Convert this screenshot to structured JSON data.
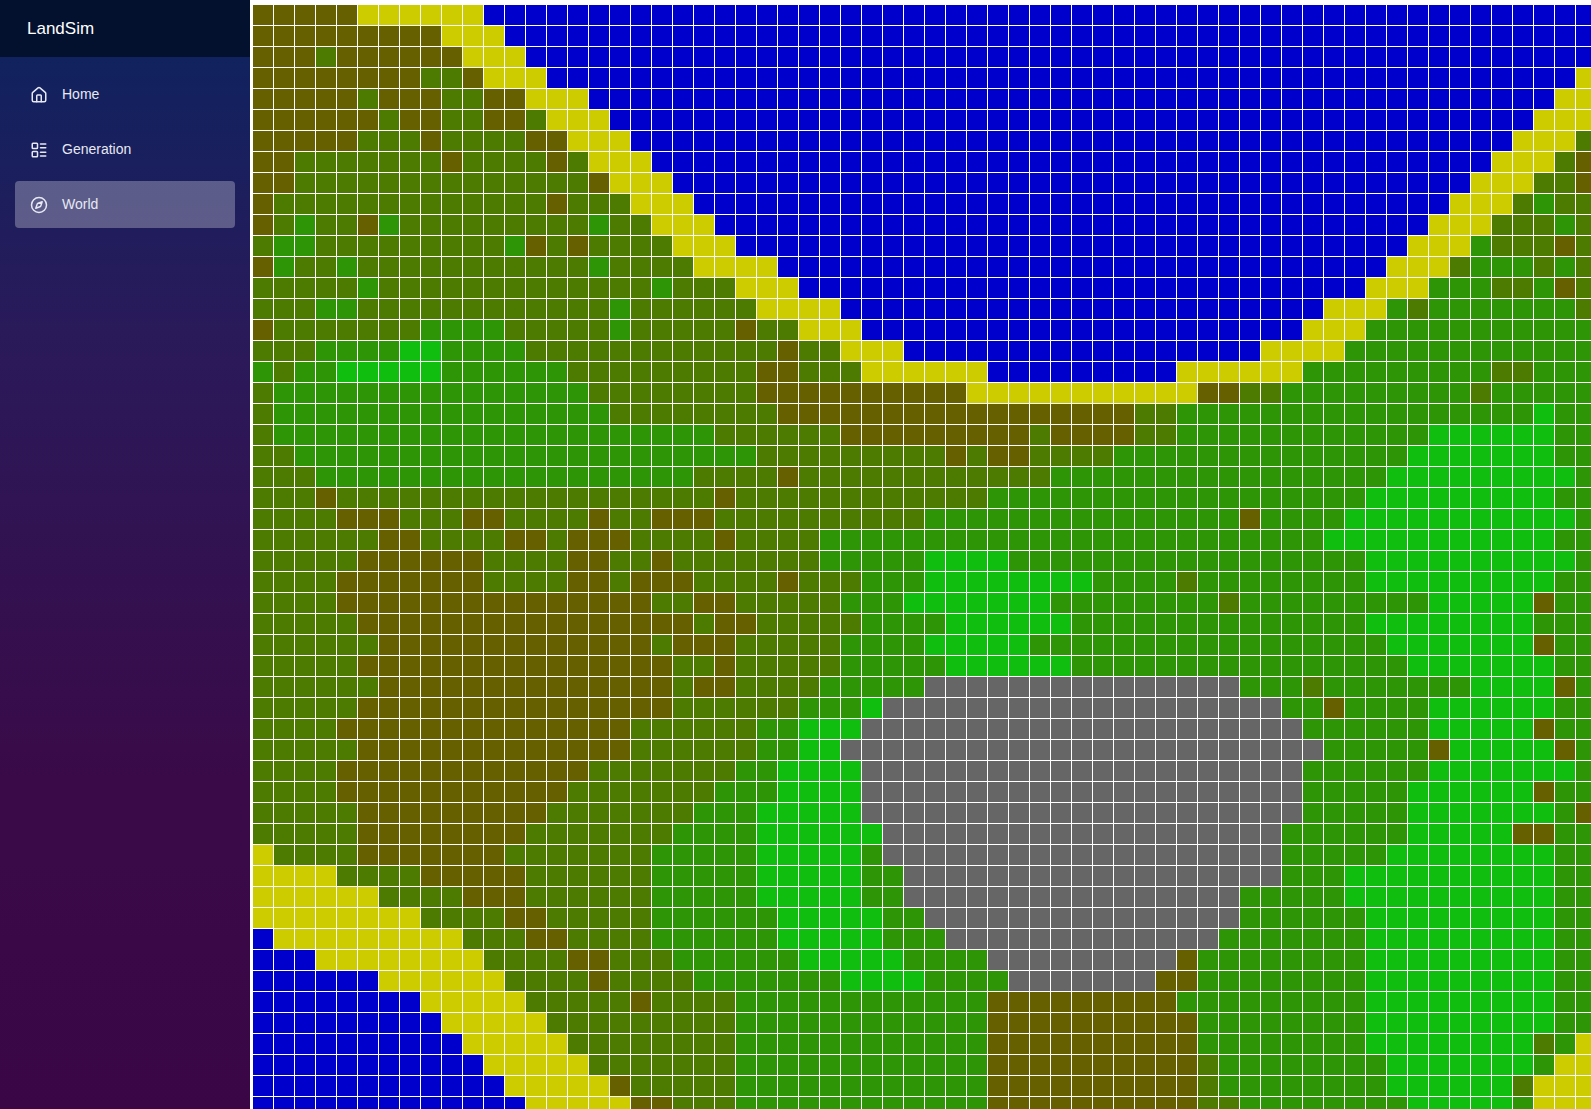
{
  "app": {
    "title": "LandSim"
  },
  "sidebar": {
    "items": [
      {
        "label": "Home",
        "selected": false
      },
      {
        "label": "Generation",
        "selected": false
      },
      {
        "label": "World",
        "selected": true
      }
    ]
  },
  "map": {
    "legend": {
      "W": "#0000cc",
      "Y": "#cccc00",
      "D": "#666000",
      "O": "#4d7a00",
      "G": "#2e9606",
      "L": "#10be10",
      "S": "#666666"
    },
    "rows": [
      "DDDDDYYYYYYWWWWWWWWWWWWWWWWWWWWWWWWWWWWWWWWWWWWWWWWWWWWWWWWWWWWW",
      "DDDDDDDDDYYYWWWWWWWWWWWWWWWWWWWWWWWWWWWWWWWWWWWWWWWWWWWWWWWWWWWW",
      "DDDODDDDDDYYYWWWWWWWWWWWWWWWWWWWWWWWWWWWWWWWWWWWWWWWWWWWWWWWWWWW",
      "DDDDDDDDOODYYYWWWWWWWWWWWWWWWWWWWWWWWWWWWWWWWWWWWWWWWWWWWWWWWWWY",
      "DDDDDODDDOODDYYYWWWWWWWWWWWWWWWWWWWWWWWWWWWWWWWWWWWWWWWWWWWWWWYY",
      "DDDDDDODDOODDOYYYWWWWWWWWWWWWWWWWWWWWWWWWWWWWWWWWWWWWWWWWWWWWYYY",
      "DDDDDOOODOOOODDYYYWWWWWWWWWWWWWWWWWWWWWWWWWWWWWWWWWWWWWWWWWWYYYO",
      "DDOOOOOOODOOOODOYYYWWWWWWWWWWWWWWWWWWWWWWWWWWWWWWWWWWWWWWWWYYYOD",
      "DDOOOOOOOOOOOOOODYYYWWWWWWWWWWWWWWWWWWWWWWWWWWWWWWWWWWWWWWYYYOOD",
      "DOOOOOOOOOOOOODOOOYYYWWWWWWWWWWWWWWWWWWWWWWWWWWWWWWWWWWWWYYYOGOO",
      "DOGOODGOOOOOOOOOGOOYYYWWWWWWWWWWWWWWWWWWWWWWWWWWWWWWWWWWYYYOOOGO",
      "OGGOOOOOOOOOGDODOOOOYYYWWWWWWWWWWWWWWWWWWWWWWWWWWWWWWWWYYYGOOODO",
      "DGOOGOOOOOOOOOOOGOOOOYYYYWWWWWWWWWWWWWWWWWWWWWWWWWWWWWYYYOGGGOGO",
      "OOOOOGOOOOOOOOOOOOOGOOOYYYWWWWWWWWWWWWWWWWWWWWWWWWWWWYYYGGGOOGDO",
      "OOOGGOOOOOOOOOOOOGOOOOOOYYYYWWWWWWWWWWWWWWWWWWWWWWWYYYGOGGGGGGGO",
      "DOOOOOOOGGGGOOOOOGOOOOODOOYYYWWWWWWWWWWWWWWWWWWWWWYYYGGGGGGGGGGG",
      "OOOGGGGLLGGGGOOOOOOOOOOOODOOYYYWWWWWWWWWWWWWWWWWYYYYGGGGGGGGGGGG",
      "GOGGLLLLLGGGGGGOOOOOOOOODDOOOYYYYYYWWWWWWWWWYYYYYYGGGGGGGGGOOGGG",
      "OGGGGGGGGGGGGGGGOOOOOOOODDDDDDDDDDYYYYYYYYYYYDDOOGGGGGGGGGOGGGGG",
      "OGGGGGGGGGGGGGGGGOOOOOOOODDDDDDDDDDDDDDDDDOOGGGGGGGGGGGGGGGGGLGG",
      "OGGGGGGGGGGGGGGGGGGGGGOOOOOODDDDDDDDDODDDDOOGGGGGGGGGGGGLLLLLLGG",
      "OOGGGGGGGGGGGGGGGGGGGGGGOOOOOOOOODODDOOOOGGGGGGGGGGGGGGLLLLLLLGG",
      "OOOGGGGGGGGGGGGGGGGGGOOOODOOOOOOOOOOOOGGGGGGGGGGGGGGGGLLLLLLLLLG",
      "OOODOOOOOOOOOOOOOOOOOODOOOOOOOOOOOOGGGGGGGGGGGGGGGGGGLLLLLLLLLGG",
      "OOOODDDOOODDOOOODOODDDOOOOOOOOOOGGGGGGGGGGGGGGGDGGGGLLLLLLLLLLLG",
      "OOOOOODDOOOODDODDDOOOODOOOOGGGGGGGGGGGGGGGGGGGGGGGGLLLLLLLLLLLGG",
      "OOOOODDDDDDOOOODDOODOOOOOOOGGGGGLLLLGGGGGGGGGGGGGGGGGLLLLLLLLLLG",
      "OOOODDDDDDDOOOODDODDDOOOODOOOGGGLLLLLLLLGGGGOGGGGGGGGLLLLLLLLLGG",
      "OOOODDDDDDDDDDDDDDDOODDOOOOOGGGLLLLLLLGGGGGGGGOGGGGGGGGGLLLLLDGG",
      "OOOOODDDDDDDDDDDDDDDDODDOOOOOGGGGLLLLLLGGGGGGGGGGGGGGLLLLLLLLGGG",
      "OOOOOODDDDDDDDDDDDDODDDOOOOOGGGGLLLLLGGGGGGGGGGGGGGGGGLLLLLLLDGG",
      "OOOOODDDDDDDDDDDDDDDOODOOOOOGGGGGLLLLLLGGGGGGGGGGGGGGGGLLLLLLLGG",
      "OOOOOODDDDDDDDDDDDDDODDOOOOGGGGGSSSSSSSSSSSSSSSGGGOGGGGGGGLLLLDG",
      "OOOOODDDDDDDDDDDDDDDOOOOOOGGGLSSSSSSSSSSSSSSSSSSSGGDGGGGLLLLLLGG",
      "OOOODDDDDDDDDDDDDDOOOOOOGGLLLSSSSSSSSSSSSSSSSSSSSSGGGGGGLLLLLDGG",
      "OOOOODDDDDDDDDDDDDOOOOOOGGLLSSSSSSSSSSSSSSSSSSSSSSSGGGGGDLLLLLDG",
      "OOOODDDDDDDDDDDDOOOOOOOGGLLLLSSSSSSSSSSSSSSSSSSSSSGGGGGGLLLLLLLG",
      "OOOODDDDDDDDDDDOOOOOOOGGGLLLLSSSSSSSSSSSSSSSSSSSSSGGGGGLLLLLLDGG",
      "OOOOODDDDDDDDDOOOOOOOGGGLLLLLSSSSSSSSSSSSSSSSSSSSSGGGGGLLLLLLLGD",
      "OOOOODDDDDDDDOOOOOOOGGGGLLLLLLSSSSSSSSSSSSSSSSSSSGGGGGGLLLLLDDGG",
      "YOOOODDDDDDDOOOOOOOGGGGGLLLLLGSSSSSSSSSSSSSSSSSSSGGGGGLLLLLLLLGG",
      "YYYYOOOODDDDDOOOOOOGGGGGLLLLLGGSSSSSSSSSSSSSSSSSSGGGLLLLLLLLLLGG",
      "YYYYYYOOOODDDOOOOOOGGGGGLLLLLGGSSSSSSSSSSSSSSSSGGGGGLLLLLLLLLLGG",
      "YYYYYYYYOOOODDOOOOOGGGGGGLLLLLGGSSSSSSSSSSSSSSSGGGGGGLLLLLLLLLGG",
      "WYYYYYYYYYOOODDOOOOGGGGGGLLLLLGGGSSSSSSSSSSSSSGGGGGGGLLLLLLLLLGG",
      "WWWYYYYYYYYOOOODDOOOGGGGGGLLLLLGGGGSSSSSSSSSDGGGGGGGGLLLLLLLLLGG",
      "WWWWWWYYYYYYOOOODOOOOGGGGGGGLLLLGGGGSSSSSSSDDGGGGGGGGLLLLLLLLLGG",
      "WWWWWWWWYYYYYOOOOODOOOOGGGGGGGGGGGGDDDDDDDDDGGGGGGGGGLLLLLLLLLGG",
      "WWWWWWWWWYYYYYOOOOOOOOOGGGGGGGGGGGGDDDDDDDDDDGGGGGGGGLLLLLLLLLGG",
      "WWWWWWWWWWYYYYYOOOOOOOOGGGGGGGGGGGGDDDDDDDDDDGGGGGGGGLLLLLLLLOGY",
      "WWWWWWWWWWWYYYYYOOOOOOOGGGGGGGGGGGGDDDDDDDDDDOGGGGGGGGLLLLLLLGYY",
      "WWWWWWWWWWWWYYYYYDOOOOOGGGGGGGGGGGGDDDDDDDDDDOGGGGGGGGLLLLLLOYYY",
      "WWWWWWWWWWWWWYYYYYDDOOOGGGGGGGGGGGGDDDDDDDDDDOOGGGGGGGGLLLLLGYYY"
    ]
  }
}
